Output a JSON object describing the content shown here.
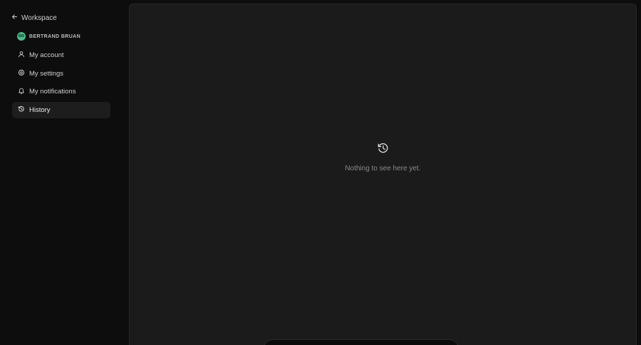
{
  "sidebar": {
    "back_label": "Workspace",
    "user": {
      "initials": "BB",
      "name": "BERTRAND BRUAN",
      "avatar_color": "#4fb98a"
    },
    "items": [
      {
        "label": "My account",
        "icon": "user-icon",
        "active": false
      },
      {
        "label": "My settings",
        "icon": "gear-icon",
        "active": false
      },
      {
        "label": "My notifications",
        "icon": "bell-icon",
        "active": false
      },
      {
        "label": "History",
        "icon": "history-icon",
        "active": true
      }
    ]
  },
  "main": {
    "empty_icon": "history-icon",
    "empty_message": "Nothing to see here yet."
  },
  "colors": {
    "background": "#0d0d0d",
    "panel": "#1b1b1b",
    "active_item": "#1d1d1d"
  }
}
